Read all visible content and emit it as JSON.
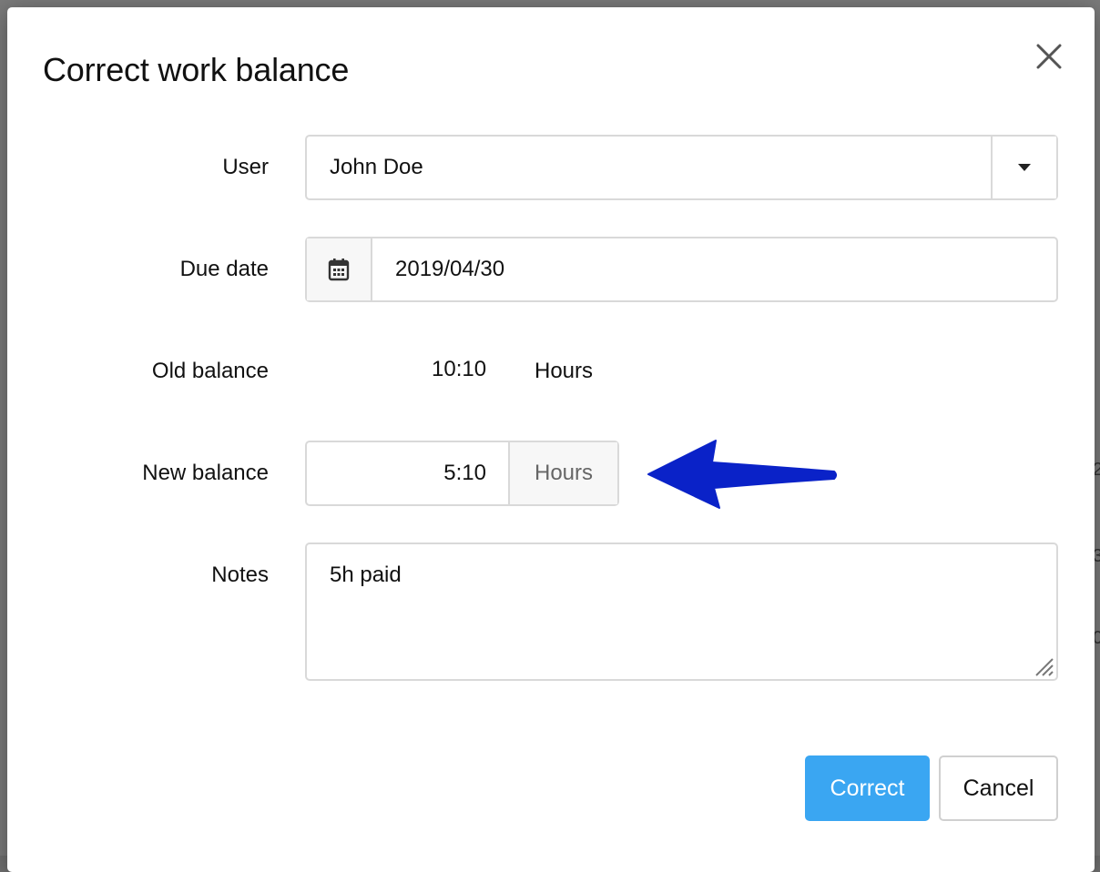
{
  "dialog": {
    "title": "Correct work balance",
    "fields": {
      "user": {
        "label": "User",
        "value": "John Doe"
      },
      "due_date": {
        "label": "Due date",
        "value": "2019/04/30"
      },
      "old_balance": {
        "label": "Old balance",
        "value": "10:10",
        "unit": "Hours"
      },
      "new_balance": {
        "label": "New balance",
        "value": "5:10",
        "unit": "Hours"
      },
      "notes": {
        "label": "Notes",
        "value": "5h paid"
      }
    },
    "buttons": {
      "correct": "Correct",
      "cancel": "Cancel"
    }
  },
  "colors": {
    "primary": "#3aa6f2",
    "annotation_arrow": "#0a22c8",
    "border": "#d9d9d9",
    "addon_bg": "#f7f7f7"
  },
  "icons": {
    "close": "close-icon",
    "dropdown": "caret-down-icon",
    "calendar": "calendar-icon",
    "resize": "resize-grip-icon",
    "annotation": "arrow-left-icon"
  }
}
